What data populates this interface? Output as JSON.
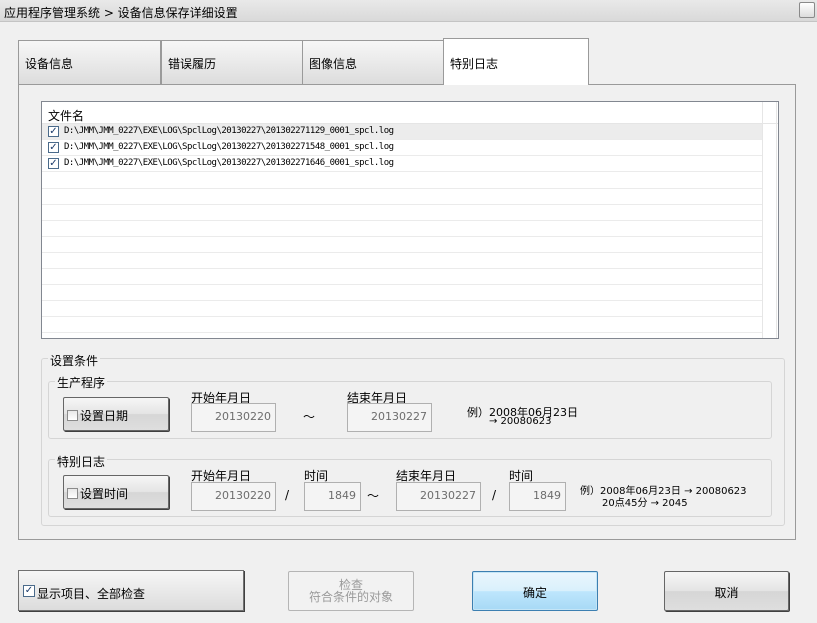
{
  "window": {
    "title": "应用程序管理系统 > 设备信息保存详细设置"
  },
  "tabs": [
    {
      "label": "设备信息",
      "active": false
    },
    {
      "label": "错误履历",
      "active": false
    },
    {
      "label": "图像信息",
      "active": false
    },
    {
      "label": "特别日志",
      "active": true
    }
  ],
  "file_list": {
    "header": "文件名",
    "rows": [
      {
        "checked": true,
        "path": "D:\\JMM\\JMM_0227\\EXE\\LOG\\SpclLog\\20130227\\201302271129_0001_spcl.log"
      },
      {
        "checked": true,
        "path": "D:\\JMM\\JMM_0227\\EXE\\LOG\\SpclLog\\20130227\\201302271548_0001_spcl.log"
      },
      {
        "checked": true,
        "path": "D:\\JMM\\JMM_0227\\EXE\\LOG\\SpclLog\\20130227\\201302271646_0001_spcl.log"
      }
    ]
  },
  "conditions": {
    "title": "设置条件",
    "production": {
      "title": "生产程序",
      "set_date_label": "设置日期",
      "start_label": "开始年月日",
      "start_value": "20130220",
      "tilde": "～",
      "end_label": "结束年月日",
      "end_value": "20130227",
      "example_line1": "例）2008年06月23日",
      "example_line2": "→ 20080623"
    },
    "special_log": {
      "title": "特别日志",
      "set_time_label": "设置时间",
      "start_label": "开始年月日",
      "start_value": "20130220",
      "time_label_1": "时间",
      "time_value_1": "1849",
      "slash": "/",
      "tilde": "～",
      "end_label": "结束年月日",
      "end_value": "20130227",
      "time_label_2": "时间",
      "time_value_2": "1849",
      "example_line1": "例）2008年06月23日 → 20080623",
      "example_line2": "20点45分 → 2045"
    }
  },
  "footer": {
    "show_all_label": "显示项目、全部检查",
    "show_all_checked": true,
    "check_button_line1": "检查",
    "check_button_line2": "符合条件的对象",
    "ok_label": "确定",
    "cancel_label": "取消"
  }
}
